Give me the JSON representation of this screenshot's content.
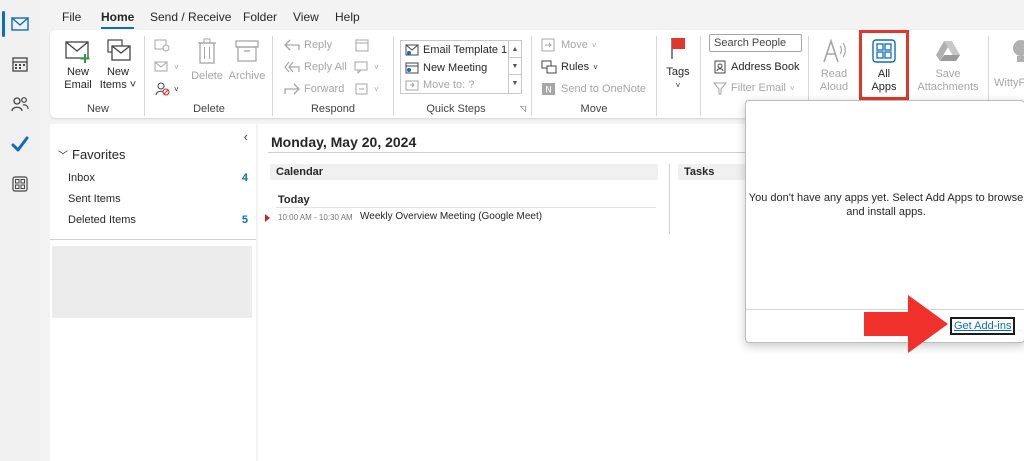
{
  "menu": {
    "tabs": [
      {
        "label": "File"
      },
      {
        "label": "Home"
      },
      {
        "label": "Send / Receive"
      },
      {
        "label": "Folder"
      },
      {
        "label": "View"
      },
      {
        "label": "Help"
      }
    ]
  },
  "ribbon": {
    "new_group": {
      "label": "New",
      "new_email": "New\nEmail",
      "new_email_l1": "New",
      "new_email_l2": "Email",
      "new_items_l1": "New",
      "new_items_l2": "Items"
    },
    "delete_group": {
      "label": "Delete",
      "delete": "Delete",
      "archive": "Archive"
    },
    "respond_group": {
      "label": "Respond",
      "reply": "Reply",
      "reply_all": "Reply All",
      "forward": "Forward"
    },
    "quick_steps_group": {
      "label": "Quick Steps",
      "items": [
        "Email Template 1",
        "New Meeting",
        "Move to: ?"
      ]
    },
    "move_group": {
      "label": "Move",
      "move": "Move",
      "rules": "Rules",
      "send_onenote": "Send to OneNote"
    },
    "tags": {
      "label": "Tags"
    },
    "find": {
      "search_placeholder": "Search People",
      "address_book": "Address Book",
      "filter_email": "Filter Email"
    },
    "read_aloud": {
      "l1": "Read",
      "l2": "Aloud"
    },
    "all_apps": {
      "l1": "All",
      "l2": "Apps"
    },
    "save_attachments": {
      "l1": "Save",
      "l2": "Attachments"
    },
    "wittyp": {
      "label": "WittyP"
    }
  },
  "folders": {
    "header": "Favorites",
    "items": [
      {
        "label": "Inbox",
        "count": "4"
      },
      {
        "label": "Sent Items",
        "count": ""
      },
      {
        "label": "Deleted Items",
        "count": "5"
      }
    ],
    "collapse_glyph": "‹"
  },
  "main": {
    "date": "Monday, May 20, 2024",
    "calendar_label": "Calendar",
    "tasks_label": "Tasks",
    "today_label": "Today",
    "appointment": {
      "time": "10:00 AM - 10:30 AM",
      "title": "Weekly Overview Meeting (Google Meet)"
    }
  },
  "popup": {
    "message": "You don't have any apps yet. Select Add Apps to browse and install apps.",
    "link": "Get Add-ins"
  },
  "colors": {
    "accent": "#0f6cbd",
    "highlight": "#e0362c",
    "arrow": "#f0302b"
  }
}
